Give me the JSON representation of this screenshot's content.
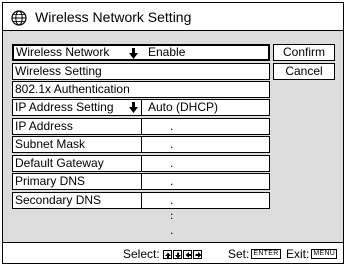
{
  "title": "Wireless Network Setting",
  "rows": [
    {
      "label": "Wireless Network",
      "value": "Enable",
      "has_dropdown": true,
      "selected": true
    },
    {
      "label": "Wireless Setting"
    },
    {
      "label": "802.1x Authentication"
    },
    {
      "label": "IP Address Setting",
      "value": "Auto (DHCP)",
      "has_dropdown": true
    },
    {
      "label": "IP Address",
      "value": ". . ."
    },
    {
      "label": "Subnet Mask",
      "value": ". . ."
    },
    {
      "label": "Default Gateway",
      "value": ". . ."
    },
    {
      "label": "Primary DNS",
      "value": ". . ."
    },
    {
      "label": "Secondary DNS",
      "value": ". . ."
    }
  ],
  "buttons": {
    "confirm": "Confirm",
    "cancel": "Cancel"
  },
  "footer": {
    "select_label": "Select:",
    "select_keys": [
      "up-arrow-key-icon",
      "down-arrow-key-icon",
      "left-arrow-key-icon",
      "right-arrow-key-icon"
    ],
    "set_label": "Set:",
    "set_key": "ENTER",
    "exit_label": "Exit:",
    "exit_key": "MENU"
  }
}
